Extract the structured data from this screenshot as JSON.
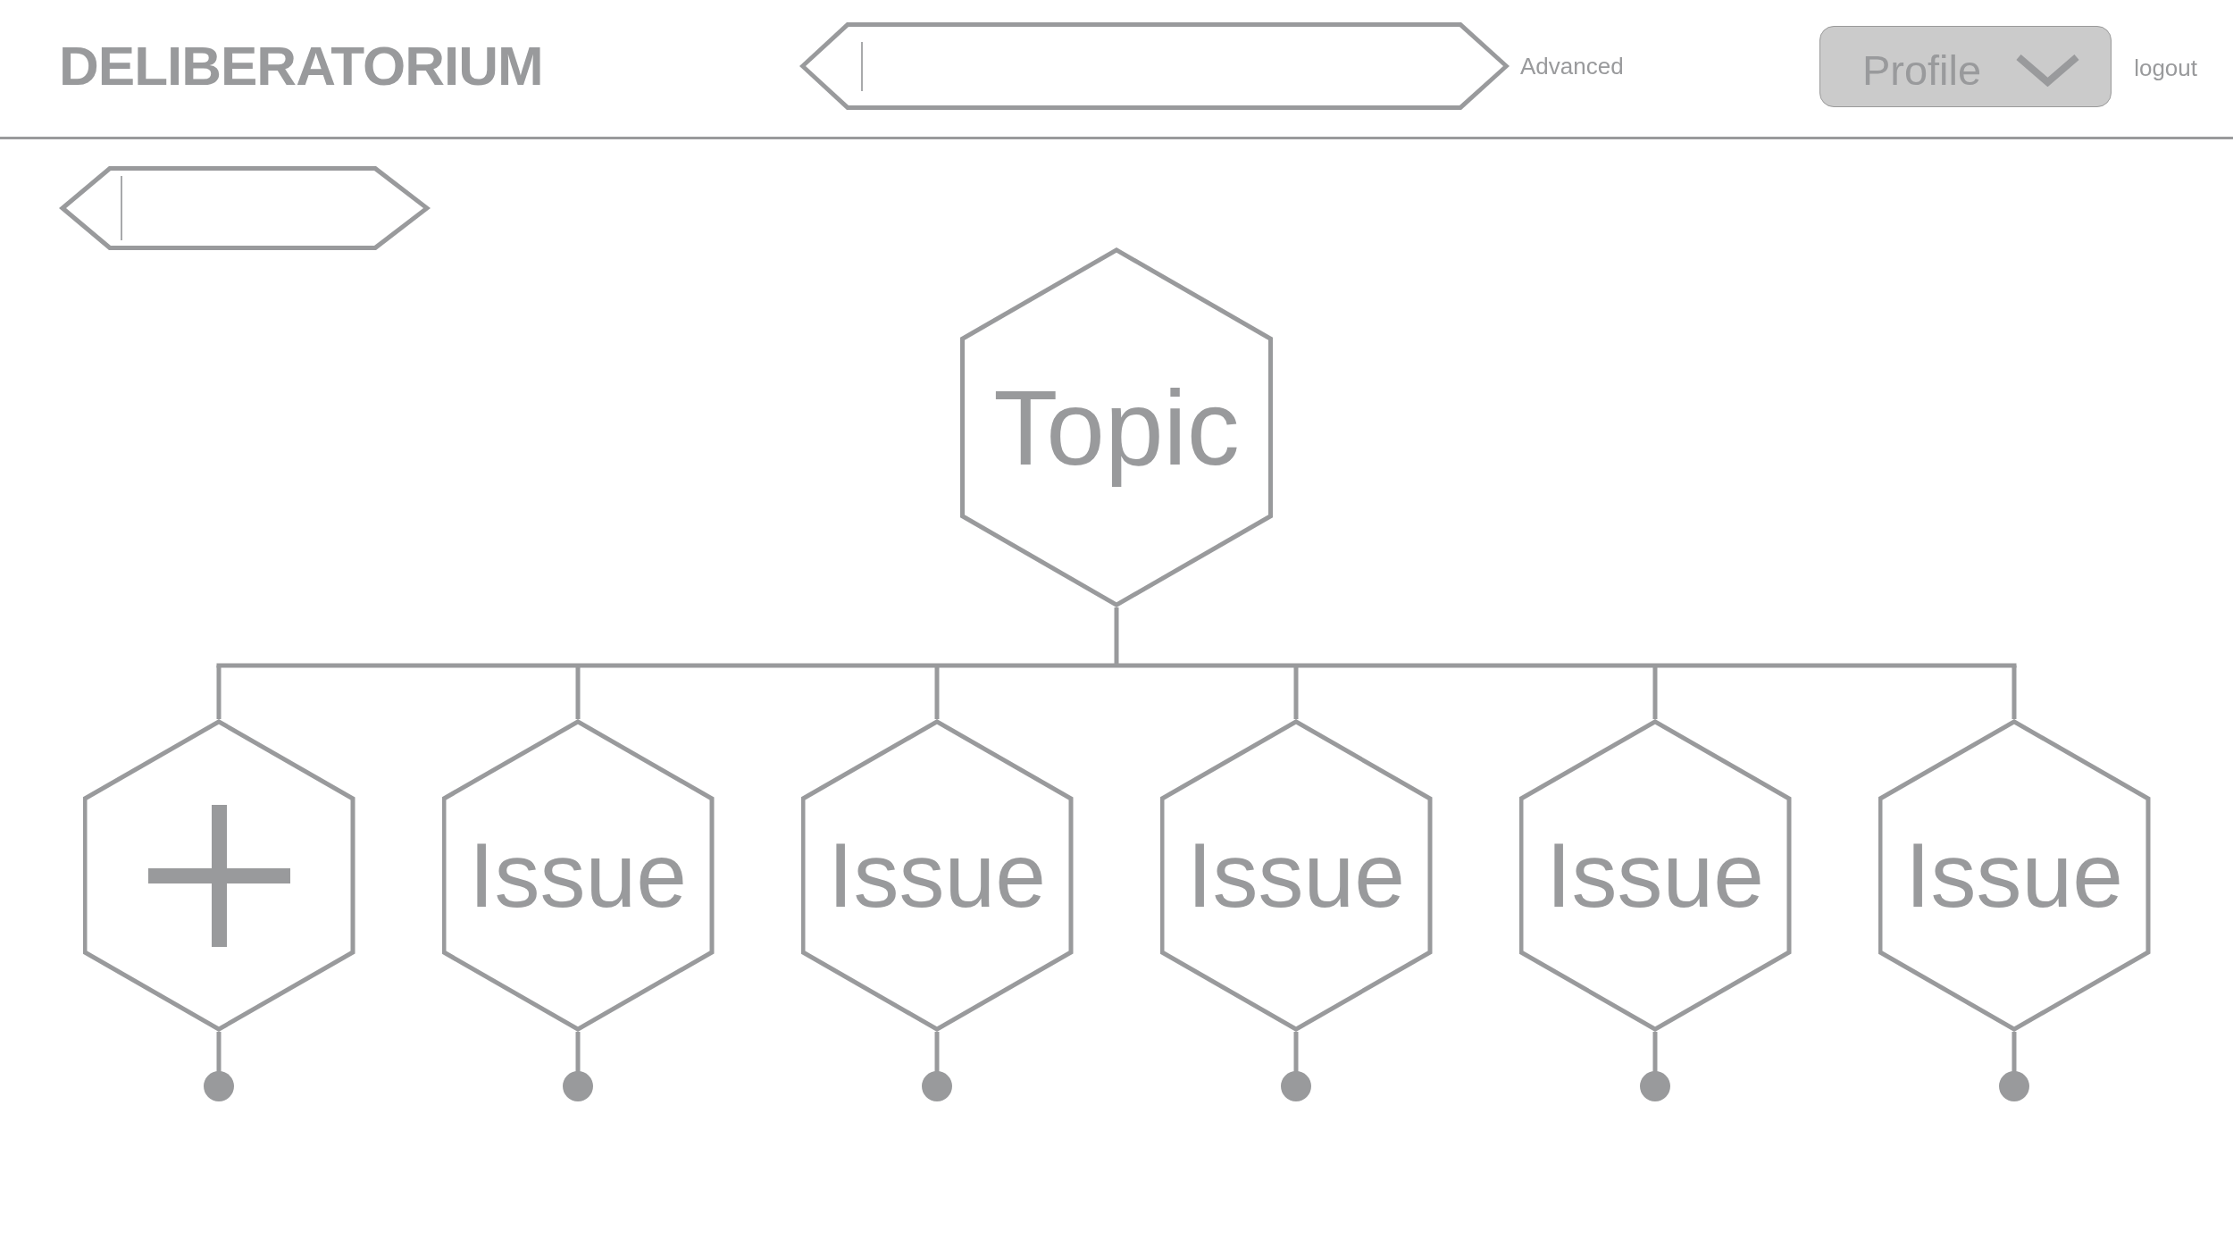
{
  "header": {
    "logo": "DELIBERATORIUM",
    "advanced_link": "Advanced",
    "profile_button": "Profile",
    "logout_link": "logout"
  },
  "diagram": {
    "topic": {
      "label": "Topic",
      "children": [
        {
          "kind": "add"
        },
        {
          "kind": "issue",
          "label": "Issue"
        },
        {
          "kind": "issue",
          "label": "Issue"
        },
        {
          "kind": "issue",
          "label": "Issue"
        },
        {
          "kind": "issue",
          "label": "Issue"
        },
        {
          "kind": "issue",
          "label": "Issue"
        }
      ]
    }
  }
}
